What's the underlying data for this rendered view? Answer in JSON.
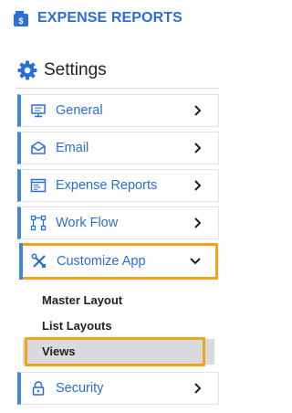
{
  "brand": {
    "title": "EXPENSE REPORTS",
    "icon": "wallet-icon"
  },
  "settings": {
    "title": "Settings",
    "icon": "gear-icon"
  },
  "menu": {
    "items": [
      {
        "label": "General",
        "icon": "monitor-icon"
      },
      {
        "label": "Email",
        "icon": "envelope-icon"
      },
      {
        "label": "Expense Reports",
        "icon": "window-list-icon"
      },
      {
        "label": "Work Flow",
        "icon": "workflow-icon"
      },
      {
        "label": "Customize App",
        "icon": "tools-icon",
        "expanded": true
      },
      {
        "label": "Security",
        "icon": "lock-icon"
      }
    ],
    "submenu": [
      {
        "label": "Master Layout"
      },
      {
        "label": "List Layouts"
      },
      {
        "label": "Views",
        "selected": true
      }
    ]
  },
  "colors": {
    "accent": "#2a6ed8",
    "highlight": "#f5a21b",
    "selected_bg": "#d8dadd"
  }
}
